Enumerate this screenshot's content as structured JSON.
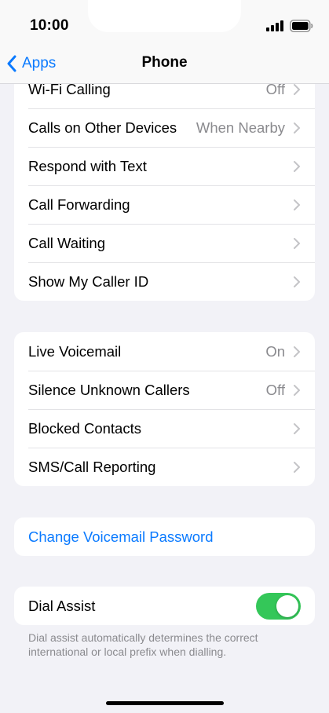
{
  "status_bar": {
    "time": "10:00"
  },
  "nav": {
    "back_label": "Apps",
    "title": "Phone"
  },
  "group1": [
    {
      "label": "Wi-Fi Calling",
      "value": "Off"
    },
    {
      "label": "Calls on Other Devices",
      "value": "When Nearby"
    },
    {
      "label": "Respond with Text",
      "value": ""
    },
    {
      "label": "Call Forwarding",
      "value": ""
    },
    {
      "label": "Call Waiting",
      "value": ""
    },
    {
      "label": "Show My Caller ID",
      "value": ""
    }
  ],
  "group2": [
    {
      "label": "Live Voicemail",
      "value": "On"
    },
    {
      "label": "Silence Unknown Callers",
      "value": "Off"
    },
    {
      "label": "Blocked Contacts",
      "value": ""
    },
    {
      "label": "SMS/Call Reporting",
      "value": ""
    }
  ],
  "voicemail": {
    "change_password_label": "Change Voicemail Password"
  },
  "dial_assist": {
    "label": "Dial Assist",
    "enabled": true,
    "footnote": "Dial assist automatically determines the correct international or local prefix when dialling."
  },
  "colors": {
    "accent": "#0a7aff",
    "toggle_on": "#34c759",
    "background": "#f2f2f7"
  }
}
